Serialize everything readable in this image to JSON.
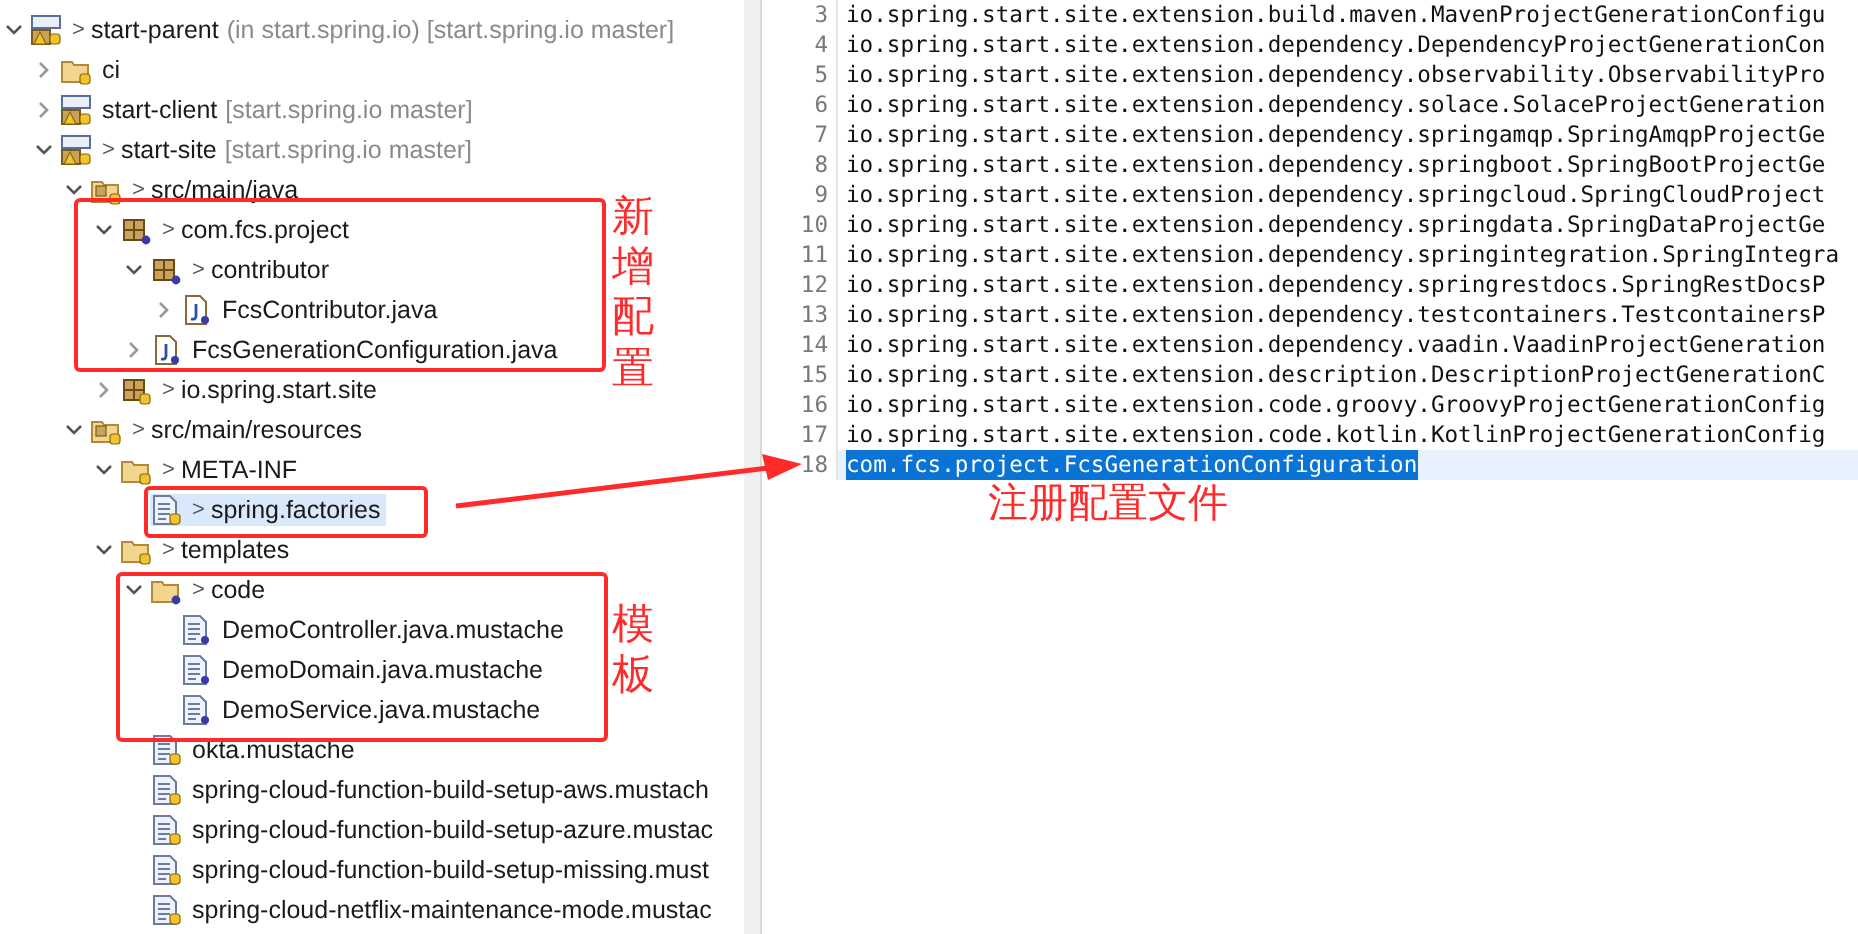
{
  "tree": [
    {
      "label": "start-parent",
      "detail": "(in start.spring.io) [start.spring.io master]",
      "marker": ">",
      "kind": "project",
      "expanded": true,
      "selected": false,
      "children": [
        {
          "label": "ci",
          "kind": "folder",
          "expanded": false,
          "selected": false
        },
        {
          "label": "start-client",
          "detail": "[start.spring.io master]",
          "kind": "project",
          "expanded": false,
          "selected": false
        },
        {
          "label": "start-site",
          "detail": "[start.spring.io master]",
          "marker": ">",
          "kind": "project",
          "expanded": true,
          "selected": false,
          "children": [
            {
              "label": "src/main/java",
              "marker": ">",
              "kind": "source-folder",
              "expanded": true,
              "selected": false,
              "children": [
                {
                  "label": "com.fcs.project",
                  "marker": ">",
                  "kind": "package-new",
                  "expanded": true,
                  "selected": false,
                  "children": [
                    {
                      "label": "contributor",
                      "marker": ">",
                      "kind": "package-new",
                      "expanded": true,
                      "selected": false,
                      "children": [
                        {
                          "label": "FcsContributor.java",
                          "kind": "java",
                          "expanded": false,
                          "selected": false
                        }
                      ]
                    },
                    {
                      "label": "FcsGenerationConfiguration.java",
                      "kind": "java",
                      "expanded": false,
                      "selected": false
                    }
                  ]
                },
                {
                  "label": "io.spring.start.site",
                  "marker": ">",
                  "kind": "package",
                  "expanded": false,
                  "selected": false
                }
              ]
            },
            {
              "label": "src/main/resources",
              "marker": ">",
              "kind": "source-folder",
              "expanded": true,
              "selected": false,
              "children": [
                {
                  "label": "META-INF",
                  "marker": ">",
                  "kind": "folder",
                  "expanded": true,
                  "selected": false,
                  "children": [
                    {
                      "label": "spring.factories",
                      "marker": ">",
                      "kind": "file",
                      "selected": true
                    }
                  ]
                },
                {
                  "label": "templates",
                  "marker": ">",
                  "kind": "folder",
                  "expanded": true,
                  "selected": false,
                  "children": [
                    {
                      "label": "code",
                      "marker": ">",
                      "kind": "folder-new",
                      "expanded": true,
                      "selected": false,
                      "children": [
                        {
                          "label": "DemoController.java.mustache",
                          "kind": "file-new",
                          "selected": false
                        },
                        {
                          "label": "DemoDomain.java.mustache",
                          "kind": "file-new",
                          "selected": false
                        },
                        {
                          "label": "DemoService.java.mustache",
                          "kind": "file-new",
                          "selected": false
                        }
                      ]
                    },
                    {
                      "label": "okta.mustache",
                      "kind": "file",
                      "selected": false
                    },
                    {
                      "label": "spring-cloud-function-build-setup-aws.mustach",
                      "kind": "file",
                      "selected": false
                    },
                    {
                      "label": "spring-cloud-function-build-setup-azure.mustac",
                      "kind": "file",
                      "selected": false
                    },
                    {
                      "label": "spring-cloud-function-build-setup-missing.must",
                      "kind": "file",
                      "selected": false
                    },
                    {
                      "label": "spring-cloud-netflix-maintenance-mode.mustac",
                      "kind": "file",
                      "selected": false
                    }
                  ]
                }
              ]
            }
          ]
        }
      ]
    }
  ],
  "editor": {
    "lines": [
      {
        "number": "3",
        "text": "io.spring.start.site.extension.build.maven.MavenProjectGenerationConfigu",
        "selected": false
      },
      {
        "number": "4",
        "text": "io.spring.start.site.extension.dependency.DependencyProjectGenerationCon",
        "selected": false
      },
      {
        "number": "5",
        "text": "io.spring.start.site.extension.dependency.observability.ObservabilityPro",
        "selected": false
      },
      {
        "number": "6",
        "text": "io.spring.start.site.extension.dependency.solace.SolaceProjectGeneration",
        "selected": false
      },
      {
        "number": "7",
        "text": "io.spring.start.site.extension.dependency.springamqp.SpringAmqpProjectGe",
        "selected": false
      },
      {
        "number": "8",
        "text": "io.spring.start.site.extension.dependency.springboot.SpringBootProjectGe",
        "selected": false
      },
      {
        "number": "9",
        "text": "io.spring.start.site.extension.dependency.springcloud.SpringCloudProject",
        "selected": false
      },
      {
        "number": "10",
        "text": "io.spring.start.site.extension.dependency.springdata.SpringDataProjectGe",
        "selected": false
      },
      {
        "number": "11",
        "text": "io.spring.start.site.extension.dependency.springintegration.SpringIntegra",
        "selected": false
      },
      {
        "number": "12",
        "text": "io.spring.start.site.extension.dependency.springrestdocs.SpringRestDocsP",
        "selected": false
      },
      {
        "number": "13",
        "text": "io.spring.start.site.extension.dependency.testcontainers.TestcontainersP",
        "selected": false
      },
      {
        "number": "14",
        "text": "io.spring.start.site.extension.dependency.vaadin.VaadinProjectGeneration",
        "selected": false
      },
      {
        "number": "15",
        "text": "io.spring.start.site.extension.description.DescriptionProjectGenerationC",
        "selected": false
      },
      {
        "number": "16",
        "text": "io.spring.start.site.extension.code.groovy.GroovyProjectGenerationConfig",
        "selected": false
      },
      {
        "number": "17",
        "text": "io.spring.start.site.extension.code.kotlin.KotlinProjectGenerationConfig",
        "selected": false
      },
      {
        "number": "18",
        "text": "com.fcs.project.FcsGenerationConfiguration",
        "selected": true
      }
    ]
  },
  "annotations": [
    {
      "kind": "vertical-note",
      "text": "新增配置"
    },
    {
      "kind": "vertical-note",
      "text": "模板"
    },
    {
      "kind": "note",
      "text": "注册配置文件"
    }
  ]
}
